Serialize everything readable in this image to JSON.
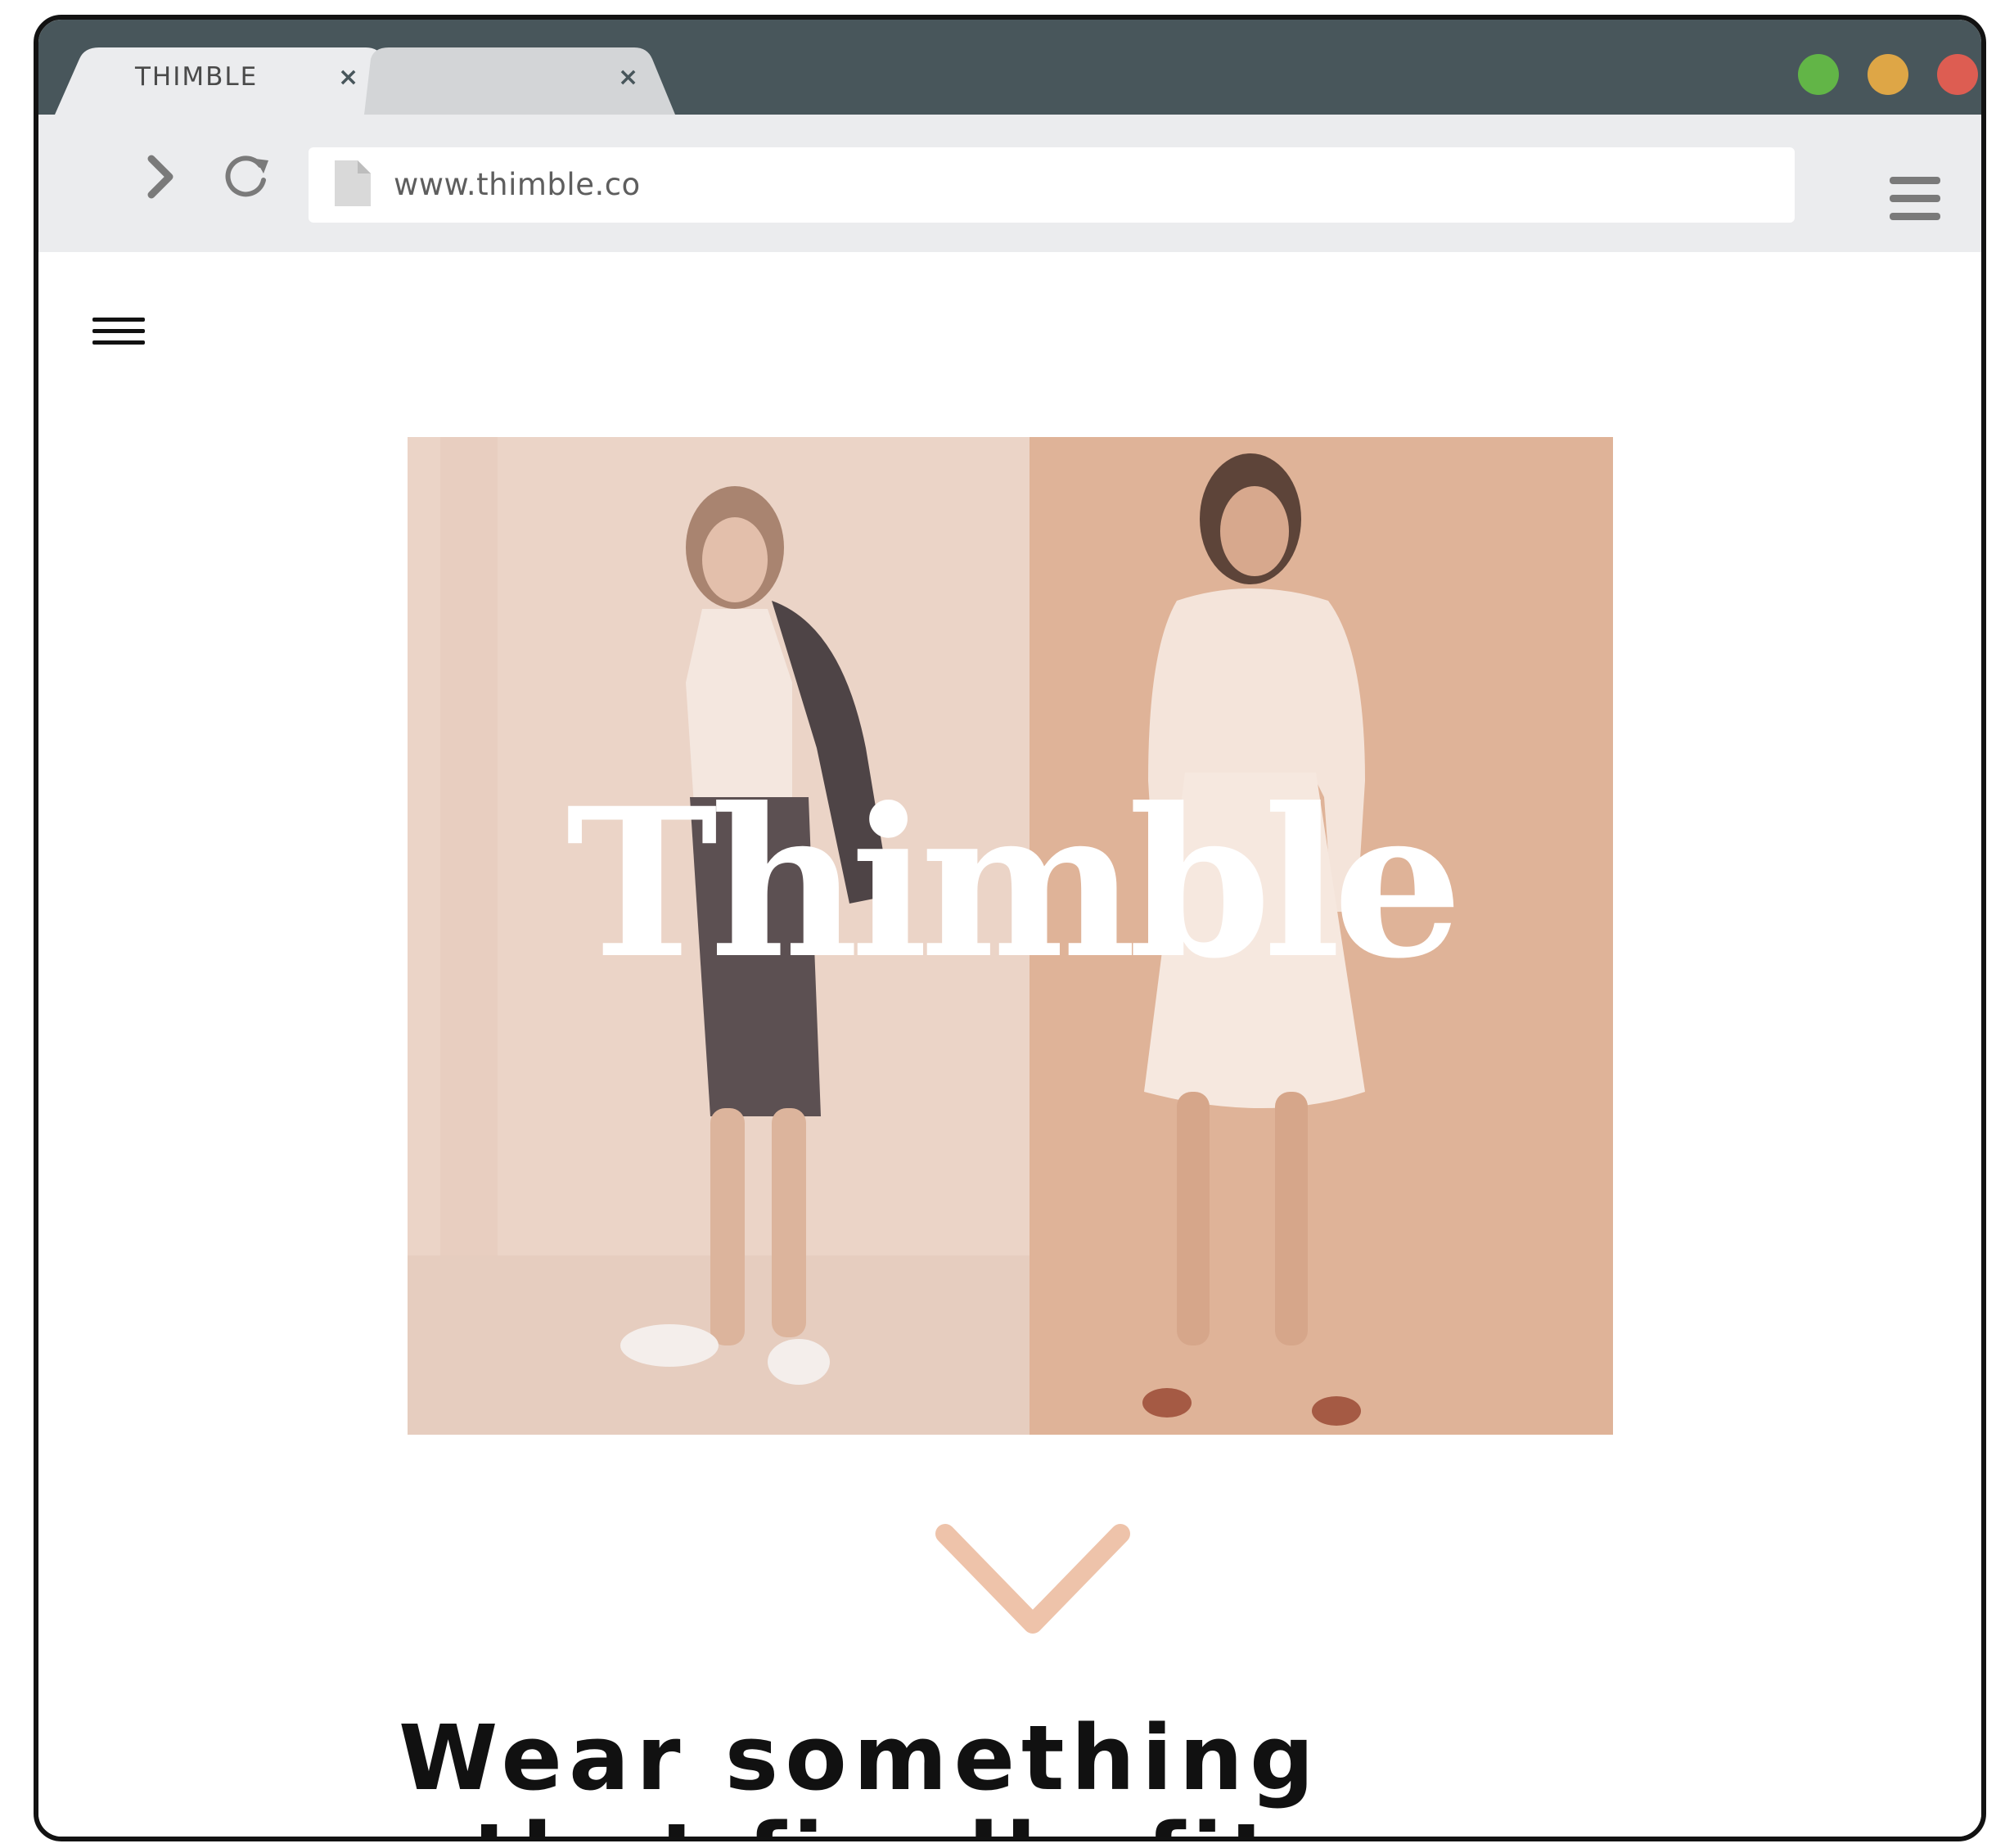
{
  "browser": {
    "tabs": [
      {
        "label": "THIMBLE",
        "close": "×",
        "active": true
      },
      {
        "label": "",
        "close": "×",
        "active": false
      }
    ],
    "window_controls": [
      {
        "name": "maximize",
        "color": "#62b547"
      },
      {
        "name": "minimize",
        "color": "#dea646"
      },
      {
        "name": "close",
        "color": "#dd5d52"
      }
    ],
    "url": "www.thimble.co",
    "icons": {
      "forward": "chevron-right-icon",
      "reload": "reload-icon",
      "page": "page-icon",
      "menu": "hamburger-icon"
    }
  },
  "site": {
    "brand": "Thimble",
    "headline_line1": "Wear something",
    "headline_line2": "that finally fits",
    "colors": {
      "accent": "#eec3aa",
      "hero_left": "#ebd4c7",
      "hero_right": "#dfb398"
    },
    "icons": {
      "menu": "menu-icon",
      "scroll": "chevron-down-icon"
    }
  }
}
